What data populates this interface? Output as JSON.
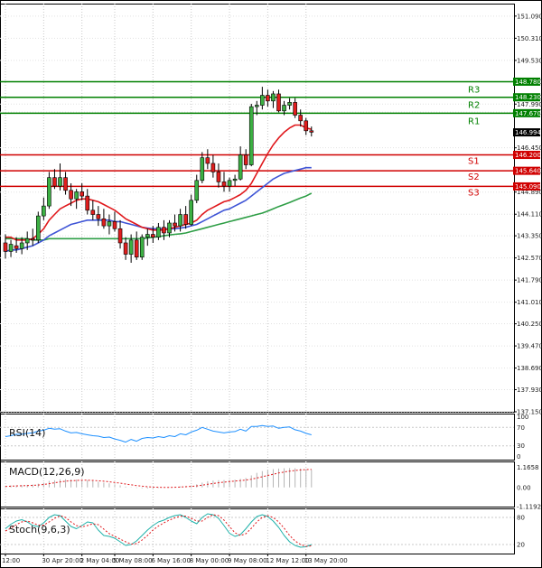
{
  "chart_data": {
    "type": "candlestick",
    "y_ticks": [
      "151.090",
      "150.310",
      "149.530",
      "148.780",
      "148.230",
      "147.990",
      "147.710",
      "146.450",
      "145.640",
      "144.890",
      "144.110",
      "143.350",
      "142.570",
      "141.790",
      "141.010",
      "140.250",
      "139.470",
      "138.690",
      "137.930",
      "137.150"
    ],
    "y_tick_values": [
      151.09,
      150.31,
      149.53,
      148.78,
      148.23,
      147.99,
      147.71,
      146.45,
      145.64,
      144.89,
      144.11,
      143.35,
      142.57,
      141.79,
      141.01,
      140.25,
      139.47,
      138.69,
      137.93,
      137.15
    ],
    "ylim": [
      137.15,
      151.53
    ],
    "x_ticks": [
      "12:00",
      "30 Apr 20:00",
      "2 May 04:00",
      "5 May 08:00",
      "6 May 16:00",
      "8 May 00:00",
      "9 May 08:00",
      "12 May 12:00",
      "13 May 20:00"
    ],
    "x_tick_candle_index": [
      0,
      7,
      14,
      20,
      27,
      34,
      41,
      48,
      55
    ],
    "candles": [
      {
        "o": 143.1,
        "h": 143.4,
        "l": 142.55,
        "c": 142.8
      },
      {
        "o": 142.8,
        "h": 143.2,
        "l": 142.6,
        "c": 143.05
      },
      {
        "o": 143.0,
        "h": 143.3,
        "l": 142.75,
        "c": 142.9
      },
      {
        "o": 142.9,
        "h": 143.3,
        "l": 142.7,
        "c": 143.1
      },
      {
        "o": 143.1,
        "h": 143.5,
        "l": 142.85,
        "c": 143.25
      },
      {
        "o": 143.25,
        "h": 143.6,
        "l": 143.0,
        "c": 143.2
      },
      {
        "o": 143.2,
        "h": 144.2,
        "l": 143.1,
        "c": 144.05
      },
      {
        "o": 144.05,
        "h": 144.7,
        "l": 143.9,
        "c": 144.4
      },
      {
        "o": 144.4,
        "h": 145.6,
        "l": 144.3,
        "c": 145.4
      },
      {
        "o": 145.4,
        "h": 145.7,
        "l": 145.0,
        "c": 145.1
      },
      {
        "o": 145.1,
        "h": 145.9,
        "l": 144.95,
        "c": 145.4
      },
      {
        "o": 145.4,
        "h": 145.6,
        "l": 144.8,
        "c": 144.95
      },
      {
        "o": 144.95,
        "h": 145.2,
        "l": 144.4,
        "c": 144.65
      },
      {
        "o": 144.65,
        "h": 145.0,
        "l": 144.3,
        "c": 144.9
      },
      {
        "o": 144.9,
        "h": 145.2,
        "l": 144.6,
        "c": 144.75
      },
      {
        "o": 144.75,
        "h": 145.0,
        "l": 144.1,
        "c": 144.25
      },
      {
        "o": 144.25,
        "h": 144.6,
        "l": 143.9,
        "c": 144.1
      },
      {
        "o": 144.1,
        "h": 144.4,
        "l": 143.7,
        "c": 143.95
      },
      {
        "o": 143.95,
        "h": 144.3,
        "l": 143.6,
        "c": 143.7
      },
      {
        "o": 143.7,
        "h": 144.1,
        "l": 143.4,
        "c": 143.85
      },
      {
        "o": 143.85,
        "h": 144.2,
        "l": 143.5,
        "c": 143.6
      },
      {
        "o": 143.6,
        "h": 143.9,
        "l": 142.9,
        "c": 143.1
      },
      {
        "o": 143.1,
        "h": 143.3,
        "l": 142.5,
        "c": 142.7
      },
      {
        "o": 142.7,
        "h": 143.4,
        "l": 142.4,
        "c": 143.2
      },
      {
        "o": 143.2,
        "h": 143.5,
        "l": 142.5,
        "c": 142.6
      },
      {
        "o": 142.6,
        "h": 143.4,
        "l": 142.5,
        "c": 143.3
      },
      {
        "o": 143.3,
        "h": 143.6,
        "l": 143.0,
        "c": 143.4
      },
      {
        "o": 143.4,
        "h": 143.7,
        "l": 143.1,
        "c": 143.3
      },
      {
        "o": 143.3,
        "h": 143.8,
        "l": 143.2,
        "c": 143.65
      },
      {
        "o": 143.65,
        "h": 143.9,
        "l": 143.2,
        "c": 143.45
      },
      {
        "o": 143.45,
        "h": 143.9,
        "l": 143.3,
        "c": 143.8
      },
      {
        "o": 143.8,
        "h": 144.1,
        "l": 143.5,
        "c": 143.7
      },
      {
        "o": 143.7,
        "h": 144.3,
        "l": 143.5,
        "c": 144.1
      },
      {
        "o": 144.1,
        "h": 144.4,
        "l": 143.6,
        "c": 143.75
      },
      {
        "o": 143.75,
        "h": 144.8,
        "l": 143.7,
        "c": 144.6
      },
      {
        "o": 144.6,
        "h": 145.5,
        "l": 144.5,
        "c": 145.3
      },
      {
        "o": 145.3,
        "h": 146.3,
        "l": 145.2,
        "c": 146.1
      },
      {
        "o": 146.1,
        "h": 146.4,
        "l": 145.7,
        "c": 145.9
      },
      {
        "o": 145.9,
        "h": 146.2,
        "l": 145.4,
        "c": 145.6
      },
      {
        "o": 145.6,
        "h": 145.9,
        "l": 145.05,
        "c": 145.25
      },
      {
        "o": 145.25,
        "h": 145.6,
        "l": 144.9,
        "c": 145.1
      },
      {
        "o": 145.1,
        "h": 145.4,
        "l": 144.9,
        "c": 145.3
      },
      {
        "o": 145.3,
        "h": 145.5,
        "l": 145.1,
        "c": 145.35
      },
      {
        "o": 145.35,
        "h": 146.5,
        "l": 145.3,
        "c": 146.2
      },
      {
        "o": 146.2,
        "h": 146.4,
        "l": 145.7,
        "c": 145.85
      },
      {
        "o": 145.85,
        "h": 148.0,
        "l": 145.8,
        "c": 147.9
      },
      {
        "o": 147.9,
        "h": 148.1,
        "l": 147.6,
        "c": 147.95
      },
      {
        "o": 147.95,
        "h": 148.6,
        "l": 147.8,
        "c": 148.3
      },
      {
        "o": 148.3,
        "h": 148.5,
        "l": 147.9,
        "c": 148.1
      },
      {
        "o": 148.1,
        "h": 148.45,
        "l": 147.85,
        "c": 148.35
      },
      {
        "o": 148.35,
        "h": 148.5,
        "l": 147.7,
        "c": 147.75
      },
      {
        "o": 147.75,
        "h": 148.1,
        "l": 147.6,
        "c": 147.95
      },
      {
        "o": 147.95,
        "h": 148.2,
        "l": 147.8,
        "c": 148.05
      },
      {
        "o": 148.05,
        "h": 148.2,
        "l": 147.5,
        "c": 147.6
      },
      {
        "o": 147.6,
        "h": 147.8,
        "l": 147.2,
        "c": 147.4
      },
      {
        "o": 147.4,
        "h": 147.5,
        "l": 146.9,
        "c": 147.05
      },
      {
        "o": 147.05,
        "h": 147.2,
        "l": 146.85,
        "c": 147.0
      }
    ],
    "ma_fast": [
      143.3,
      143.3,
      143.2,
      143.2,
      143.2,
      143.25,
      143.4,
      143.6,
      143.9,
      144.1,
      144.3,
      144.4,
      144.5,
      144.6,
      144.65,
      144.65,
      144.6,
      144.55,
      144.45,
      144.35,
      144.25,
      144.1,
      143.95,
      143.85,
      143.75,
      143.65,
      143.6,
      143.55,
      143.55,
      143.55,
      143.6,
      143.65,
      143.7,
      143.75,
      143.8,
      143.9,
      144.1,
      144.25,
      144.35,
      144.45,
      144.55,
      144.6,
      144.7,
      144.8,
      144.95,
      145.2,
      145.55,
      145.9,
      146.25,
      146.55,
      146.8,
      147.0,
      147.15,
      147.25,
      147.25,
      147.15,
      147.1
    ],
    "ma_mid": [
      142.8,
      142.85,
      142.85,
      142.9,
      142.95,
      143.0,
      143.1,
      143.2,
      143.35,
      143.45,
      143.55,
      143.65,
      143.75,
      143.8,
      143.85,
      143.9,
      143.9,
      143.9,
      143.9,
      143.9,
      143.85,
      143.85,
      143.8,
      143.75,
      143.7,
      143.65,
      143.62,
      143.6,
      143.6,
      143.6,
      143.6,
      143.6,
      143.62,
      143.65,
      143.7,
      143.75,
      143.85,
      143.95,
      144.05,
      144.15,
      144.25,
      144.3,
      144.4,
      144.5,
      144.6,
      144.75,
      144.9,
      145.05,
      145.2,
      145.35,
      145.45,
      145.55,
      145.6,
      145.65,
      145.7,
      145.75,
      145.75
    ],
    "ma_slow": [
      143.25,
      143.25,
      143.25,
      143.25,
      143.25,
      143.2,
      143.2,
      143.2,
      143.25,
      143.25,
      143.25,
      143.25,
      143.25,
      143.25,
      143.25,
      143.25,
      143.25,
      143.25,
      143.25,
      143.25,
      143.25,
      143.25,
      143.25,
      143.25,
      143.25,
      143.25,
      143.27,
      143.3,
      143.32,
      143.35,
      143.38,
      143.4,
      143.42,
      143.45,
      143.5,
      143.55,
      143.6,
      143.65,
      143.7,
      143.75,
      143.8,
      143.85,
      143.9,
      143.95,
      144.0,
      144.05,
      144.1,
      144.15,
      144.22,
      144.3,
      144.38,
      144.45,
      144.52,
      144.6,
      144.68,
      144.75,
      144.85
    ],
    "levels": [
      {
        "name": "R3",
        "value": 148.78,
        "color": "#008000"
      },
      {
        "name": "R2",
        "value": 148.23,
        "color": "#008000"
      },
      {
        "name": "R1",
        "value": 147.67,
        "color": "#008000"
      },
      {
        "name": "S1",
        "value": 146.2,
        "color": "#d00000"
      },
      {
        "name": "S2",
        "value": 145.64,
        "color": "#d00000"
      },
      {
        "name": "S3",
        "value": 145.09,
        "color": "#d00000"
      }
    ],
    "level_boxes": [
      "148.780",
      "148.230",
      "147.670",
      "146.200",
      "145.640",
      "145.090"
    ],
    "current_price": "146.994",
    "current_price_value": 146.994,
    "rsi": {
      "label": "RSI(14)",
      "ticks": [
        "100",
        "70",
        "30",
        "0"
      ],
      "tick_values": [
        100,
        70,
        30,
        0
      ],
      "values": [
        50,
        52,
        55,
        55,
        57,
        58,
        62,
        64,
        68,
        66,
        67,
        62,
        58,
        59,
        56,
        54,
        52,
        51,
        48,
        49,
        45,
        42,
        38,
        44,
        40,
        46,
        48,
        47,
        50,
        48,
        52,
        50,
        56,
        54,
        60,
        64,
        70,
        66,
        62,
        60,
        58,
        60,
        61,
        66,
        62,
        72,
        72,
        74,
        72,
        73,
        68,
        70,
        71,
        65,
        62,
        57,
        54
      ]
    },
    "macd": {
      "label": "MACD(12,26,9)",
      "ticks": [
        "1.1658",
        "0.00",
        "-1.1192"
      ],
      "tick_values": [
        1.1658,
        0.0,
        -1.1192
      ],
      "histogram": [
        0.1,
        0.12,
        0.12,
        0.13,
        0.15,
        0.17,
        0.22,
        0.28,
        0.38,
        0.42,
        0.47,
        0.48,
        0.47,
        0.46,
        0.44,
        0.42,
        0.38,
        0.33,
        0.28,
        0.24,
        0.18,
        0.12,
        0.05,
        0.02,
        -0.03,
        -0.05,
        -0.06,
        -0.05,
        -0.03,
        -0.01,
        0.01,
        0.03,
        0.06,
        0.08,
        0.12,
        0.18,
        0.28,
        0.36,
        0.4,
        0.42,
        0.43,
        0.44,
        0.45,
        0.5,
        0.55,
        0.7,
        0.85,
        0.95,
        1.02,
        1.07,
        1.1,
        1.12,
        1.13,
        1.12,
        1.1,
        1.06,
        1.02
      ],
      "signal": [
        0.05,
        0.07,
        0.09,
        0.1,
        0.11,
        0.12,
        0.14,
        0.17,
        0.22,
        0.27,
        0.32,
        0.36,
        0.39,
        0.41,
        0.42,
        0.42,
        0.41,
        0.39,
        0.36,
        0.33,
        0.29,
        0.25,
        0.2,
        0.15,
        0.11,
        0.07,
        0.04,
        0.02,
        0.01,
        0.0,
        0.0,
        0.01,
        0.02,
        0.04,
        0.06,
        0.09,
        0.13,
        0.18,
        0.23,
        0.27,
        0.31,
        0.34,
        0.37,
        0.4,
        0.43,
        0.48,
        0.55,
        0.62,
        0.7,
        0.77,
        0.84,
        0.9,
        0.95,
        0.99,
        1.02,
        1.04,
        1.05
      ]
    },
    "stoch": {
      "label": "Stoch(9,6,3)",
      "ticks": [
        "80",
        "20"
      ],
      "tick_values": [
        80,
        20
      ],
      "main": [
        55,
        65,
        72,
        75,
        70,
        62,
        60,
        68,
        80,
        86,
        84,
        72,
        60,
        55,
        62,
        70,
        68,
        52,
        40,
        38,
        34,
        26,
        18,
        20,
        28,
        40,
        52,
        62,
        70,
        74,
        80,
        84,
        86,
        80,
        72,
        66,
        80,
        88,
        86,
        78,
        62,
        45,
        38,
        42,
        55,
        70,
        82,
        86,
        82,
        72,
        58,
        40,
        26,
        18,
        14,
        15,
        20
      ],
      "signal": [
        50,
        56,
        64,
        70,
        72,
        68,
        63,
        63,
        70,
        78,
        84,
        80,
        70,
        62,
        59,
        62,
        66,
        64,
        54,
        44,
        38,
        32,
        26,
        21,
        22,
        30,
        40,
        52,
        61,
        68,
        74,
        79,
        83,
        83,
        78,
        72,
        72,
        80,
        86,
        84,
        74,
        60,
        46,
        40,
        44,
        56,
        70,
        80,
        84,
        80,
        70,
        56,
        40,
        28,
        20,
        16,
        17
      ]
    }
  }
}
